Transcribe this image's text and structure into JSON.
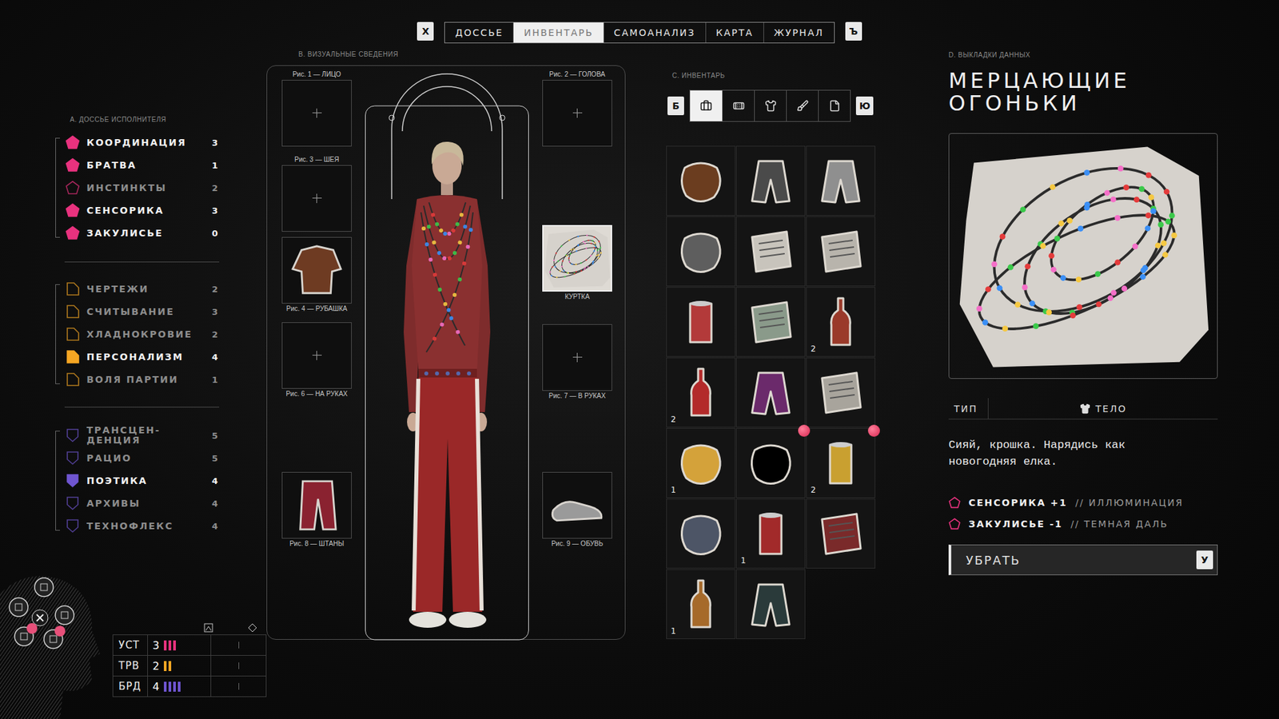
{
  "nav": {
    "close_key": "Х",
    "next_key": "Ъ",
    "tabs": [
      {
        "label": "ДОССЬЕ",
        "selected": false
      },
      {
        "label": "ИНВЕНТАРЬ",
        "selected": true
      },
      {
        "label": "САМОАНАЛИЗ",
        "selected": false
      },
      {
        "label": "КАРТА",
        "selected": false
      },
      {
        "label": "ЖУРНАЛ",
        "selected": false
      }
    ]
  },
  "dossier": {
    "title": "А. ДОССЬЕ ИСПОЛНИТЕЛЯ",
    "groups": [
      {
        "kind": "pentagon",
        "color": "#e8327e",
        "skills": [
          {
            "name": "КООРДИНАЦИЯ",
            "value": "3",
            "active": true
          },
          {
            "name": "БРАТВА",
            "value": "1",
            "active": true
          },
          {
            "name": "ИНСТИНКТЫ",
            "value": "2",
            "active": false
          },
          {
            "name": "СЕНСОРИКА",
            "value": "3",
            "active": true
          },
          {
            "name": "ЗАКУЛИСЬЕ",
            "value": "0",
            "active": true
          }
        ]
      },
      {
        "kind": "tab",
        "color": "#f5a623",
        "skills": [
          {
            "name": "ЧЕРТЕЖИ",
            "value": "2",
            "active": false
          },
          {
            "name": "СЧИТЫВАНИЕ",
            "value": "3",
            "active": false
          },
          {
            "name": "ХЛАДНОКРОВИЕ",
            "value": "2",
            "active": false
          },
          {
            "name": "ПЕРСОНАЛИЗМ",
            "value": "4",
            "active": true
          },
          {
            "name": "ВОЛЯ ПАРТИИ",
            "value": "1",
            "active": false
          }
        ]
      },
      {
        "kind": "shield",
        "color": "#6f55d0",
        "skills": [
          {
            "name": "ТРАНСЦЕН-ДЕНЦИЯ",
            "value": "5",
            "active": false
          },
          {
            "name": "РАЦИО",
            "value": "5",
            "active": false
          },
          {
            "name": "ПОЭТИКА",
            "value": "4",
            "active": true
          },
          {
            "name": "АРХИВЫ",
            "value": "4",
            "active": false
          },
          {
            "name": "ТЕХНОФЛЕКС",
            "value": "4",
            "active": false
          }
        ]
      }
    ]
  },
  "stats": [
    {
      "name": "УСТ",
      "value": "3",
      "pips": 3,
      "color": "#e8327e"
    },
    {
      "name": "ТРВ",
      "value": "2",
      "pips": 2,
      "color": "#f5a623"
    },
    {
      "name": "БРД",
      "value": "4",
      "pips": 4,
      "color": "#6f55d0"
    }
  ],
  "visual": {
    "title": "В. ВИЗУАЛЬНЫЕ СВЕДЕНИЯ",
    "slots_left": [
      {
        "label": "Рис. 1 — ЛИЦО",
        "filled": false,
        "selected": false
      },
      {
        "label": "Рис. 3 — ШЕЯ",
        "filled": false,
        "selected": false
      },
      {
        "label": "Рис. 4 — РУБАШКА",
        "filled": true,
        "selected": false
      },
      {
        "label": "Рис. 6 — НА РУКАХ",
        "filled": false,
        "selected": false
      },
      {
        "label": "Рис. 8 — ШТАНЫ",
        "filled": true,
        "selected": false
      }
    ],
    "slots_right": [
      {
        "label": "Рис. 2 — ГОЛОВА",
        "filled": false,
        "selected": false
      },
      {
        "label": "КУРТКА",
        "filled": true,
        "selected": true
      },
      {
        "label": "Рис. 7 — В РУКАХ",
        "filled": false,
        "selected": false
      },
      {
        "label": "Рис. 9 — ОБУВЬ",
        "filled": true,
        "selected": false
      }
    ]
  },
  "inventory": {
    "title": "С. ИНВЕНТАРЬ",
    "prev_key": "Б",
    "next_key": "Ю",
    "filters": [
      {
        "selected": true
      },
      {
        "selected": false
      },
      {
        "selected": false
      },
      {
        "selected": false
      },
      {
        "selected": false
      }
    ],
    "items": [
      {
        "new": false
      },
      {
        "new": false
      },
      {
        "new": false
      },
      {
        "new": false
      },
      {
        "new": false
      },
      {
        "new": false
      },
      {
        "new": false
      },
      {
        "new": false
      },
      {
        "count": "2",
        "new": false
      },
      {
        "count": "2",
        "new": false
      },
      {
        "new": false
      },
      {
        "new": false
      },
      {
        "count": "1",
        "new": false
      },
      {
        "new": true
      },
      {
        "count": "2",
        "new": true
      },
      {
        "new": false
      },
      {
        "count": "1",
        "new": false
      },
      {
        "new": false
      },
      {
        "count": "1",
        "new": false
      },
      {
        "new": false
      }
    ]
  },
  "details": {
    "title": "D. ВЫКЛАДКИ ДАННЫХ",
    "name": "МЕРЦАЮЩИЕ ОГОНЬКИ",
    "type_label": "ТИП",
    "type_value": "ТЕЛО",
    "description": "Сияй, крошка. Нарядись как новогодняя елка.",
    "modifiers": [
      {
        "skill": "СЕНСОРИКА +1",
        "effect": "// ИЛЛЮМИНАЦИЯ",
        "color": "#e8327e"
      },
      {
        "skill": "ЗАКУЛИСЬЕ -1",
        "effect": "// ТЕМНАЯ ДАЛЬ",
        "color": "#e8327e"
      }
    ],
    "button": {
      "label": "УБРАТЬ",
      "key": "У"
    }
  }
}
